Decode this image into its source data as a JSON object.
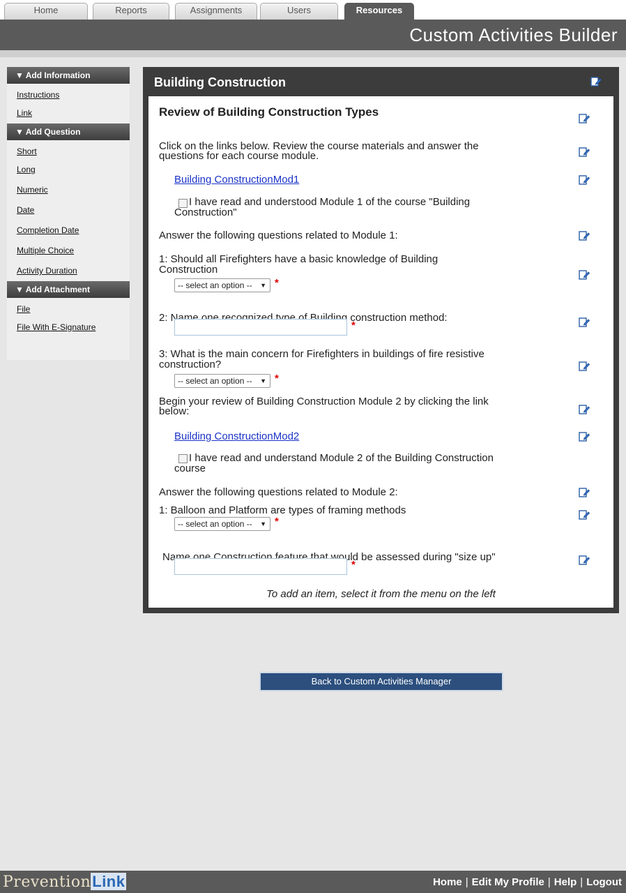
{
  "tabs": [
    {
      "label": "Home",
      "active": false
    },
    {
      "label": "Reports",
      "active": false
    },
    {
      "label": "Assignments",
      "active": false
    },
    {
      "label": "Users",
      "active": false
    },
    {
      "label": "Resources",
      "active": true
    }
  ],
  "header": {
    "title": "Custom Activities Builder"
  },
  "sidebar": {
    "sections": [
      {
        "title": "▼ Add Information",
        "items": [
          "Instructions",
          "Link"
        ]
      },
      {
        "title": "▼ Add Question",
        "items": [
          "Short",
          "Long",
          "Numeric",
          "Date",
          "Completion Date",
          "Multiple Choice",
          "Activity Duration"
        ]
      },
      {
        "title": "▼ Add Attachment",
        "items": [
          "File",
          "File With E-Signature"
        ]
      }
    ]
  },
  "panel": {
    "title": "Building Construction",
    "heading": "Review of Building Construction Types",
    "intro_1": "Click on the links below. Review the course materials and answer the",
    "intro_2": "questions for each course module.",
    "link_1": "Building ConstructionMod1",
    "check_1a": "I have read and understood Module 1 of the course \"Building",
    "check_1b": "Construction\"",
    "m1_intro": "Answer the following questions related to Module 1:",
    "q1a": "1: Should all Firefighters have a basic knowledge of Building",
    "q1b": "Construction",
    "q2": "2: Name one recognized type of Building construction method:",
    "q3a": "3: What is the main concern for Firefighters in buildings of fire resistive",
    "q3b": "construction?",
    "m2_a": "Begin your review of Building Construction Module 2 by clicking the link",
    "m2_b": "below:",
    "link_2": "Building ConstructionMod2",
    "check_2a": "I have read and understand Module 2 of the Building Construction",
    "check_2b": "course",
    "m2_intro": "Answer the following questions related to Module 2:",
    "q4": "1: Balloon and Platform are types of framing methods",
    "q5": "Name one Construction feature that would be assessed during \"size up\"",
    "select_placeholder": "-- select an option --",
    "required_mark": "*",
    "hint": "To add an item, select it from the menu on the left"
  },
  "back_button": "Back to Custom Activities Manager",
  "footer": {
    "logo_a": "Prevention",
    "logo_b": "Link",
    "nav": [
      "Home",
      "Edit My Profile",
      "Help",
      "Logout"
    ],
    "separator": "|"
  }
}
